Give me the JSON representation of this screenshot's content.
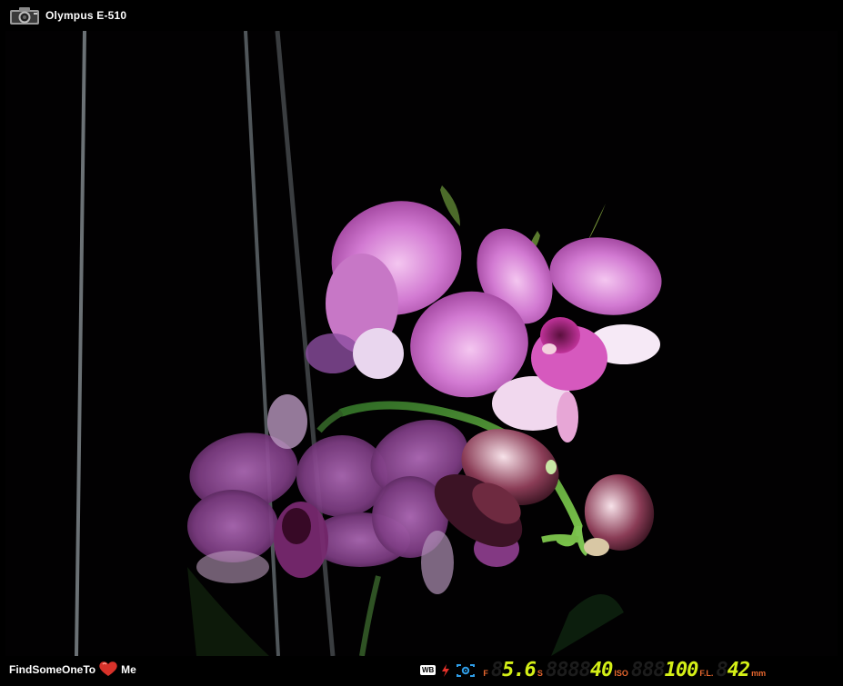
{
  "header": {
    "camera_model": "Olympus E-510",
    "camera_icon": "camera-icon"
  },
  "photo": {
    "subject": "pink orchid flowers on a green stem against a black background, with thin dark support stakes"
  },
  "footer": {
    "brand_text_before": "FindSomeOneTo",
    "brand_heart_icon": "heart-icon",
    "brand_text_after": "Me",
    "wb_label": "WB",
    "flash_icon": "flash-icon",
    "metering_icon": "metering-icon",
    "aperture_label": "F",
    "aperture_value": "5.6",
    "aperture_ghost": "8",
    "shutter_label": "S",
    "shutter_value": "40",
    "shutter_ghost": "8888",
    "iso_label": "ISO",
    "iso_value": "100",
    "iso_ghost": "888",
    "focal_label": "F.L.",
    "focal_value": "42",
    "focal_ghost": "8",
    "focal_unit": "mm",
    "accent_color": "#e8672e",
    "readout_color": "#d4ef17"
  }
}
